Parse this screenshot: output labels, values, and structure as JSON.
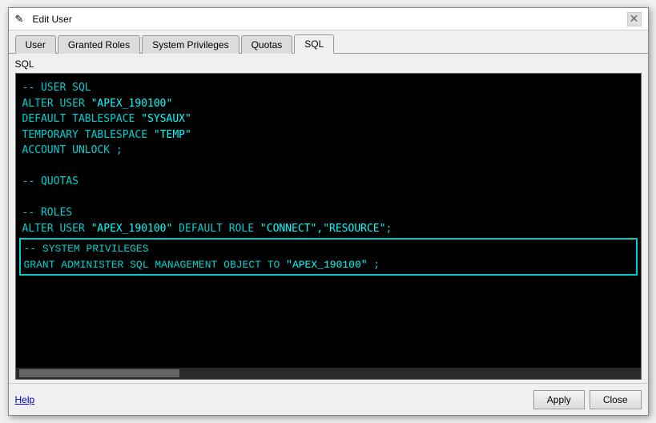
{
  "window": {
    "title": "Edit User",
    "icon": "✎"
  },
  "tabs": [
    {
      "id": "user",
      "label": "User",
      "active": false
    },
    {
      "id": "granted-roles",
      "label": "Granted Roles",
      "active": false
    },
    {
      "id": "system-privileges",
      "label": "System Privileges",
      "active": false
    },
    {
      "id": "quotas",
      "label": "Quotas",
      "active": false
    },
    {
      "id": "sql",
      "label": "SQL",
      "active": true
    }
  ],
  "sql_section_label": "SQL",
  "sql_lines": [
    {
      "type": "comment",
      "text": "-- USER SQL"
    },
    {
      "type": "mixed",
      "parts": [
        {
          "class": "keyword",
          "text": "ALTER USER "
        },
        {
          "class": "string",
          "text": "\"APEX_190100\""
        }
      ]
    },
    {
      "type": "mixed",
      "parts": [
        {
          "class": "keyword",
          "text": "DEFAULT TABLESPACE "
        },
        {
          "class": "string",
          "text": "\"SYSAUX\""
        }
      ]
    },
    {
      "type": "mixed",
      "parts": [
        {
          "class": "keyword",
          "text": "TEMPORARY TABLESPACE "
        },
        {
          "class": "string",
          "text": "\"TEMP\""
        }
      ]
    },
    {
      "type": "keyword",
      "text": "ACCOUNT UNLOCK ;"
    },
    {
      "type": "blank"
    },
    {
      "type": "comment",
      "text": "-- QUOTAS"
    },
    {
      "type": "blank"
    },
    {
      "type": "comment",
      "text": "-- ROLES"
    },
    {
      "type": "mixed",
      "parts": [
        {
          "class": "keyword",
          "text": "ALTER USER "
        },
        {
          "class": "string",
          "text": "\"APEX_190100\""
        },
        {
          "class": "keyword",
          "text": " DEFAULT ROLE "
        },
        {
          "class": "string",
          "text": "\"CONNECT\",\"RESOURCE\""
        },
        {
          "class": "keyword",
          "text": ";"
        }
      ]
    },
    {
      "type": "blank"
    },
    {
      "type": "highlighted_start"
    },
    {
      "type": "comment",
      "text": "-- SYSTEM PRIVILEGES"
    },
    {
      "type": "mixed",
      "parts": [
        {
          "class": "keyword",
          "text": "GRANT ADMINISTER SQL MANAGEMENT OBJECT TO "
        },
        {
          "class": "string",
          "text": "\"APEX_190100\""
        },
        {
          "class": "keyword",
          "text": " ;"
        }
      ]
    },
    {
      "type": "highlighted_end"
    }
  ],
  "footer": {
    "help_label": "Help",
    "apply_label": "Apply",
    "close_label": "Close"
  }
}
